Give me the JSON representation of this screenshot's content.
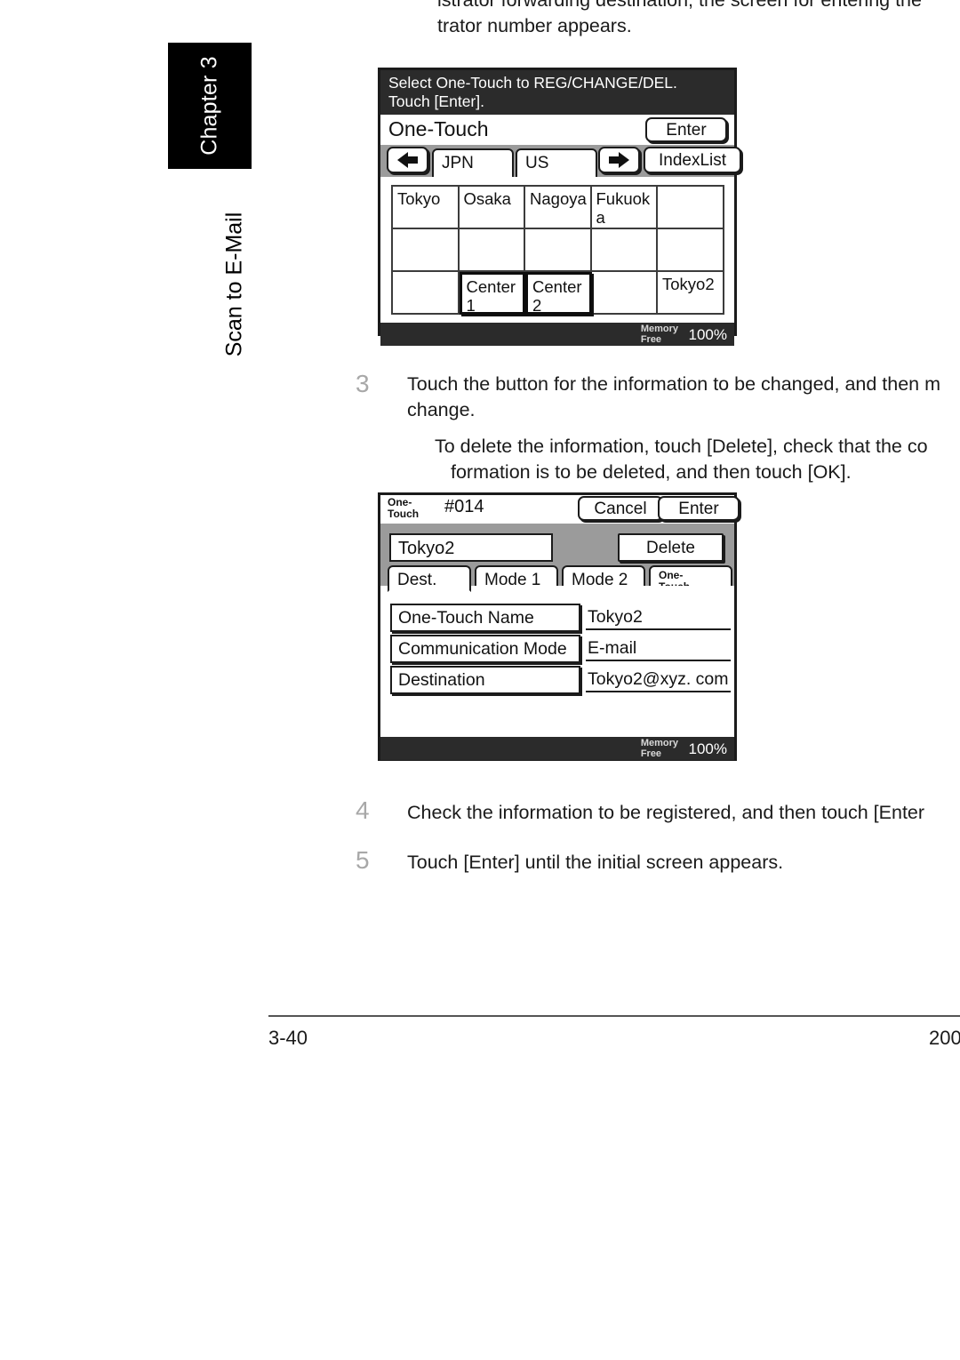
{
  "page": {
    "chapter_tab": "Chapter 3",
    "section_label": "Scan to E-Mail",
    "footer_page_number": "3-40",
    "footer_year": "200"
  },
  "intro": {
    "line1": "istrator forwarding destination, the screen for entering the",
    "line2": "trator number appears."
  },
  "steps": [
    {
      "number": "3",
      "line1": "Touch the button for the information to be changed, and then m",
      "line2": "change.",
      "sub_line1": "To delete the information, touch [Delete], check that the co",
      "sub_line2": "formation is to be deleted, and then touch [OK]."
    },
    {
      "number": "4",
      "line1": "Check the information to be registered, and then touch [Enter"
    },
    {
      "number": "5",
      "line1": "Touch [Enter] until the initial screen appears."
    }
  ],
  "panel_one_touch_select": {
    "message_line1": "Select One-Touch to REG/CHANGE/DEL.",
    "message_line2": "Touch [Enter].",
    "title": "One-Touch",
    "enter_button": "Enter",
    "prev_arrow_icon": "arrow-left-icon",
    "next_arrow_icon": "arrow-right-icon",
    "index_tabs": [
      "JPN",
      "US"
    ],
    "index_list_button": "IndexList",
    "grid": [
      {
        "label": "Tokyo",
        "selected": false
      },
      {
        "label": "Osaka",
        "selected": false
      },
      {
        "label": "Nagoya",
        "selected": false
      },
      {
        "label": "Fukuoka",
        "selected": false
      },
      {
        "label": "",
        "selected": false
      },
      {
        "label": "",
        "selected": false
      },
      {
        "label": "",
        "selected": false
      },
      {
        "label": "",
        "selected": false
      },
      {
        "label": "",
        "selected": false
      },
      {
        "label": "",
        "selected": false
      },
      {
        "label": "",
        "selected": false
      },
      {
        "label": "Center 1",
        "selected": true
      },
      {
        "label": "Center 2",
        "selected": true
      },
      {
        "label": "",
        "selected": false
      },
      {
        "label": "Tokyo2",
        "selected": false
      }
    ],
    "memory_label_line1": "Memory",
    "memory_label_line2": "Free",
    "memory_percent": "100%"
  },
  "panel_one_touch_detail": {
    "header_label_line1": "One-",
    "header_label_line2": "Touch",
    "header_number": "#014",
    "cancel_button": "Cancel",
    "enter_button": "Enter",
    "name_field_value": "Tokyo2",
    "delete_button": "Delete",
    "tabs": [
      {
        "label": "Dest.",
        "active": true,
        "two_line": false
      },
      {
        "label": "Mode 1",
        "active": false,
        "two_line": false
      },
      {
        "label": "Mode 2",
        "active": false,
        "two_line": false
      },
      {
        "label_line1": "One-",
        "label_line2": "Touch",
        "active": false,
        "two_line": true
      }
    ],
    "rows": [
      {
        "button": "One-Touch Name",
        "value": "Tokyo2"
      },
      {
        "button": "Communication Mode",
        "value": "E-mail"
      },
      {
        "button": "Destination",
        "value": "Tokyo2@xyz. com"
      }
    ],
    "memory_label_line1": "Memory",
    "memory_label_line2": "Free",
    "memory_percent": "100%"
  },
  "colors": {
    "lcd_border": "#1b1b1b",
    "lcd_dark_bar": "#2b2b2b",
    "lcd_gray": "#9b9b9b",
    "step_number": "#a8a8a8"
  }
}
